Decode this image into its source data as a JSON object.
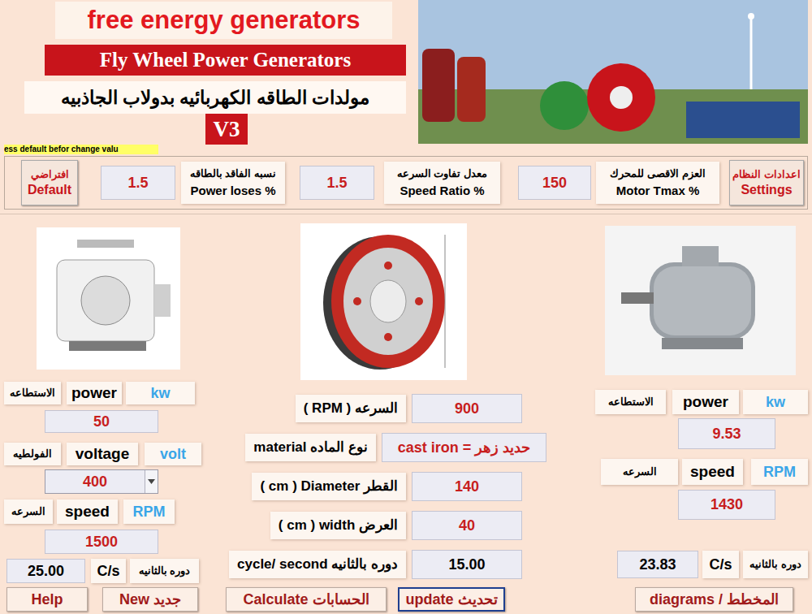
{
  "header": {
    "title": "free energy generators",
    "subtitle": "Fly Wheel Power Generators",
    "arabic_title": "مولدات الطاقه الكهربائيه  بدولاب الجاذبيه",
    "version": "V3"
  },
  "notice": "ess default befor change valu",
  "settings": {
    "default_button": {
      "ar": "افتراضي",
      "en": "Default"
    },
    "fields": [
      {
        "value": "1.5",
        "ar": "نسبه الفاقد بالطاقه",
        "en": "Power loses %"
      },
      {
        "value": "1.5",
        "ar": "معدل تفاوت السرعه",
        "en": "Speed  Ratio %"
      },
      {
        "value": "150",
        "ar": "العزم الاقصى للمحرك",
        "en": "Motor  Tmax  %"
      }
    ],
    "settings_button": {
      "ar": "اعدادات النظام",
      "en": "Settings"
    }
  },
  "generator": {
    "rows": [
      {
        "ar": "الاستطاعه",
        "en": "power",
        "unit": "kw",
        "value": "50",
        "kind": "field"
      },
      {
        "ar": "الفولطيه",
        "en": "voltage",
        "unit": "volt",
        "value": "400",
        "kind": "select"
      },
      {
        "ar": "السرعه",
        "en": "speed",
        "unit": "RPM",
        "value": "1500",
        "kind": "field"
      }
    ],
    "cycles": {
      "value": "25.00",
      "unit": "C/s",
      "ar": "دوره بالثانيه"
    }
  },
  "flywheel": {
    "rows": [
      {
        "label": "( RPM )  السرعه",
        "value": "900",
        "kind": "input"
      },
      {
        "label": "material نوع الماده",
        "value": "cast iron = حديد زهر",
        "kind": "input"
      },
      {
        "label": "( cm ) Diameter  القطر",
        "value": "140",
        "kind": "input"
      },
      {
        "label": "( cm )  width العرض",
        "value": "40",
        "kind": "input"
      },
      {
        "label": "cycle/ second دوره بالثانيه",
        "value": "15.00",
        "kind": "output"
      }
    ]
  },
  "motor": {
    "rows": [
      {
        "ar": "الاستطاعه",
        "en": "power",
        "unit": "kw",
        "value": "9.53",
        "kind": "field"
      },
      {
        "ar": "السرعه",
        "en": "speed",
        "unit": "RPM",
        "value": "1430",
        "kind": "field"
      }
    ],
    "cycles": {
      "value": "23.83",
      "unit": "C/s",
      "ar": "دوره بالثانيه"
    }
  },
  "buttons": [
    {
      "label": "Help",
      "selected": false
    },
    {
      "label": "New  جديد",
      "selected": false
    },
    {
      "label": "Calculate  الحسابات",
      "selected": false
    },
    {
      "label": "update  تحديث",
      "selected": true
    },
    {
      "label": "diagrams / المخطط",
      "selected": false
    }
  ]
}
